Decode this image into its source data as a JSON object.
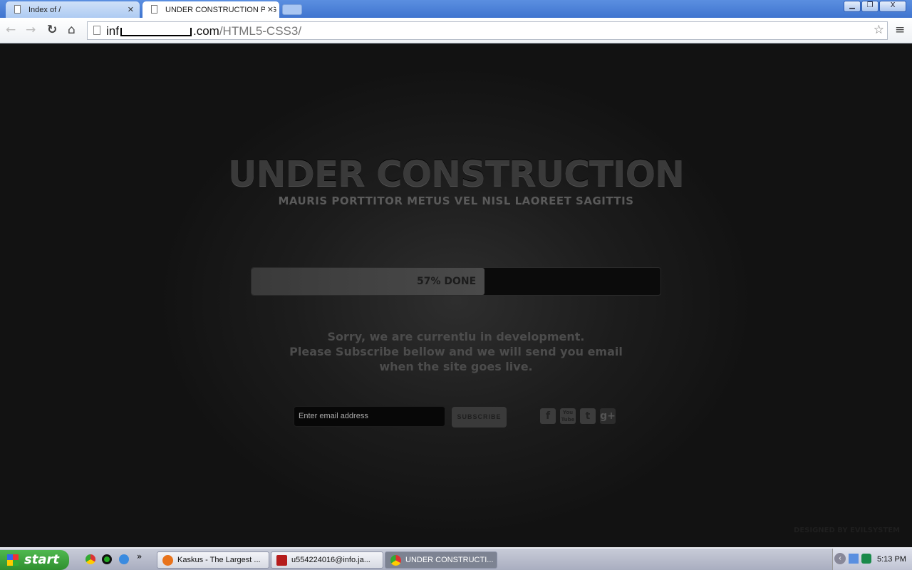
{
  "browser": {
    "tabs": [
      {
        "label": "Index of /",
        "active": false
      },
      {
        "label": "UNDER CONSTRUCTION PAG",
        "active": true
      }
    ],
    "url_prefix": "inf",
    "url_domain": ".com",
    "url_path": "/HTML5-CSS3/",
    "window_controls": {
      "minimize": "▁",
      "restore": "❐",
      "close": "X"
    }
  },
  "page": {
    "title": "UNDER CONSTRUCTION",
    "subtitle": "MAURIS PORTTITOR METUS VEL NISL LAOREET SAGITTIS",
    "progress_percent": 57,
    "progress_label": "57% DONE",
    "message_lines": [
      "Sorry, we are currentlu in development.",
      "Please Subscribe bellow and we will send you email",
      "when the site goes live."
    ],
    "email_placeholder": "Enter email address",
    "subscribe_label": "SUBSCRIBE",
    "social": [
      {
        "name": "facebook",
        "glyph": "f"
      },
      {
        "name": "youtube",
        "glyph": "You Tube"
      },
      {
        "name": "twitter",
        "glyph": "t"
      },
      {
        "name": "google-plus",
        "glyph": "g+"
      }
    ],
    "credit": "DESIGNED BY EVILSYSTEM"
  },
  "taskbar": {
    "start_label": "start",
    "tasks": [
      {
        "label": "Kaskus - The Largest ...",
        "active": false
      },
      {
        "label": "u554224016@info.ja...",
        "active": false
      },
      {
        "label": "UNDER CONSTRUCTI...",
        "active": true
      }
    ],
    "clock": "5:13 PM",
    "more": "»"
  }
}
